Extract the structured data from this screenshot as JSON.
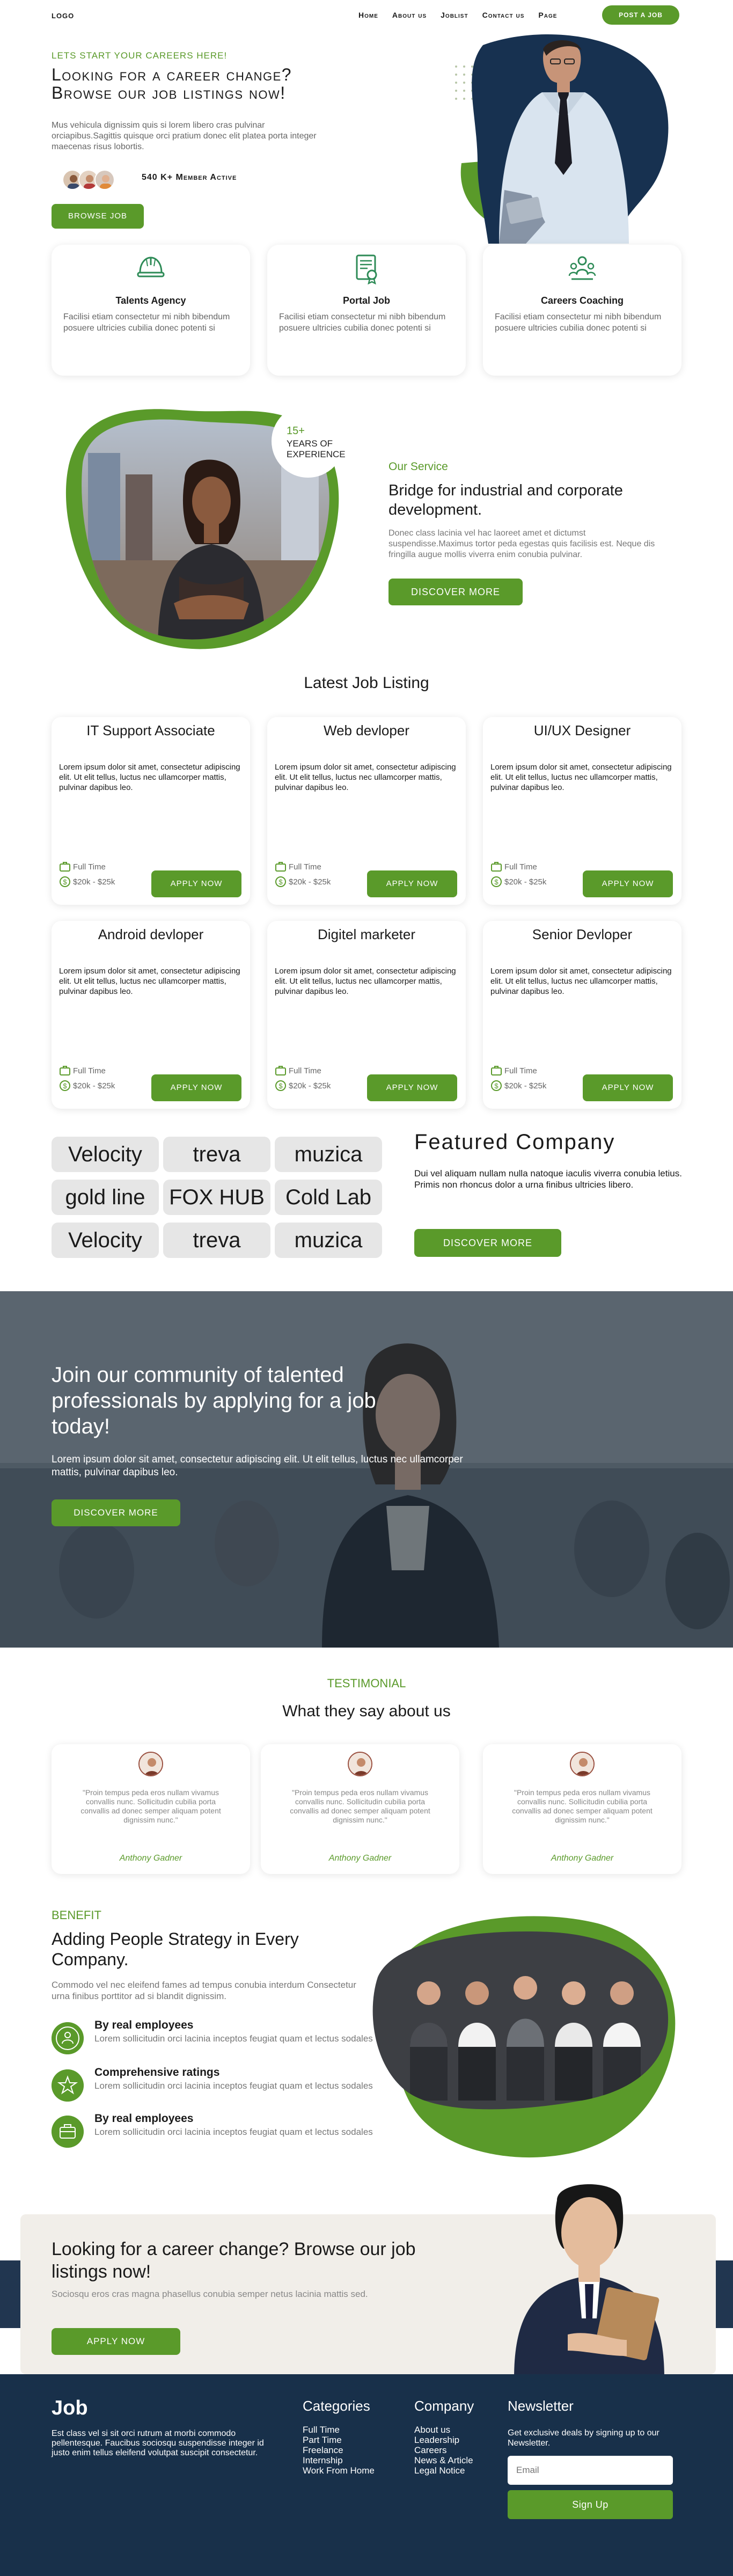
{
  "nav": {
    "logo": "LOGO",
    "links": [
      "Home",
      "About us",
      "Joblist",
      "Contact us",
      "Page"
    ],
    "post_job": "POST A JOB"
  },
  "hero": {
    "kicker": "LETS START YOUR CAREERS HERE!",
    "title": "Looking for a career change? Browse our job listings now!",
    "text": "Mus vehicula dignissim quis si lorem libero cras pulvinar orciapibus.Sagittis quisque orci pratium donec elit platea porta integer maecenas risus lobortis.",
    "members": "540 K+ Member Active",
    "browse": "BROWSE JOB"
  },
  "features": [
    {
      "icon": "helmet-icon",
      "title": "Talents Agency",
      "text": "Facilisi etiam consectetur mi nibh bibendum posuere ultricies cubilia donec potenti si"
    },
    {
      "icon": "certificate-icon",
      "title": "Portal Job",
      "text": "Facilisi etiam consectetur mi nibh bibendum posuere ultricies cubilia donec potenti si"
    },
    {
      "icon": "team-icon",
      "title": "Careers Coaching",
      "text": "Facilisi etiam consectetur mi nibh bibendum posuere ultricies cubilia donec potenti si"
    }
  ],
  "about": {
    "badge_number": "15+",
    "badge_text": "YEARS OF EXPERIENCE",
    "kicker": "Our Service",
    "title": "Bridge for industrial and corporate development.",
    "text": "Donec class lacinia vel hac laoreet amet et dictumst suspendisse.Maximus tortor peda egestas quis facilisis est. Neque dis fringilla augue mollis viverra enim conubia pulvinar.",
    "button": "DISCOVER MORE"
  },
  "jobs": {
    "title": "Latest Job Listing",
    "desc": "Lorem ipsum dolor sit amet, consectetur adipiscing elit. Ut elit tellus, luctus nec ullamcorper mattis, pulvinar dapibus leo.",
    "type": "Full Time",
    "salary": "$20k - $25k",
    "apply": "APPLY NOW",
    "items": [
      "IT Support Associate",
      "Web devloper",
      "UI/UX Designer",
      "Android devloper",
      "Digitel marketer",
      "Senior Devloper"
    ]
  },
  "companies": {
    "tags": [
      "Velocity",
      "treva",
      "muzica",
      "gold line",
      "FOX HUB",
      "Cold Lab",
      "Velocity",
      "treva",
      "muzica"
    ],
    "title": "Featured Company",
    "text": "Dui vel aliquam nullam nulla natoque iaculis viverra conubia letius. Primis non rhoncus dolor a urna finibus ultricies libero.",
    "button": "DISCOVER MORE"
  },
  "banner": {
    "title": "Join our community of talented professionals by applying for a job today!",
    "text": "Lorem ipsum dolor sit amet, consectetur adipiscing elit. Ut elit tellus, luctus nec ullamcorper mattis, pulvinar dapibus leo.",
    "button": "DISCOVER MORE"
  },
  "testimonial": {
    "kicker": "TESTIMONIAL",
    "title": "What they say about us",
    "items": [
      {
        "quote": "\"Proin tempus peda eros nullam vivamus convallis nunc. Sollicitudin cubilia porta convallis ad donec semper aliquam potent dignissim nunc.\"",
        "name": "Anthony Gadner"
      },
      {
        "quote": "\"Proin tempus peda eros nullam vivamus convallis nunc. Sollicitudin cubilia porta convallis ad donec semper aliquam potent dignissim nunc.\"",
        "name": "Anthony Gadner"
      },
      {
        "quote": "\"Proin tempus peda eros nullam vivamus convallis nunc. Sollicitudin cubilia porta convallis ad donec semper aliquam potent dignissim nunc.\"",
        "name": "Anthony Gadner"
      }
    ]
  },
  "benefit": {
    "kicker": "BENEFIT",
    "title": "Adding People Strategy in Every Company.",
    "text": "Commodo vel nec eleifend fames ad tempus conubia interdum Consectetur urna finibus porttitor ad si blandit dignissim.",
    "items": [
      {
        "icon": "employee-icon",
        "title": "By real employees",
        "text": "Lorem sollicitudin orci lacinia inceptos feugiat quam et lectus sodales"
      },
      {
        "icon": "rating-icon",
        "title": "Comprehensive ratings",
        "text": "Lorem sollicitudin orci lacinia inceptos feugiat quam et lectus sodales"
      },
      {
        "icon": "briefcase-icon",
        "title": "By real employees",
        "text": "Lorem sollicitudin orci lacinia inceptos feugiat quam et lectus sodales"
      }
    ]
  },
  "cta": {
    "title": "Looking for a career change? Browse our job listings now!",
    "text": "Sociosqu eros cras magna phasellus conubia semper netus lacinia mattis sed.",
    "button": "APPLY NOW"
  },
  "footer": {
    "logo": "Job",
    "about": "Est class vel si sit orci rutrum at morbi commodo pellentesque. Faucibus sociosqu suspendisse integer id justo enim tellus eleifend volutpat suscipit consectetur.",
    "categories_title": "Categories",
    "categories": [
      "Full Time",
      "Part Time",
      "Freelance",
      "Internship",
      "Work From Home"
    ],
    "company_title": "Company",
    "company": [
      "About us",
      "Leadership",
      "Careers",
      "News & Article",
      "Legal Notice"
    ],
    "newsletter_title": "Newsletter",
    "newsletter_text": "Get exclusive deals by signing up to our Newsletter.",
    "email_placeholder": "Email",
    "signup": "Sign Up"
  },
  "colors": {
    "accent": "#5a9a2a",
    "dark": "#18304a",
    "tag_bg": "#e6e6e6"
  }
}
